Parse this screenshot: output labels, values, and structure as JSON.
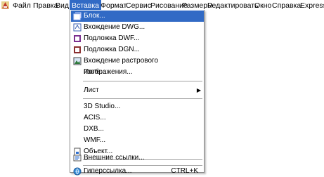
{
  "menubar": {
    "items": [
      {
        "label": "Файл"
      },
      {
        "label": "Правка"
      },
      {
        "label": "Вид"
      },
      {
        "label": "Вставка"
      },
      {
        "label": "Формат"
      },
      {
        "label": "Сервис"
      },
      {
        "label": "Рисование"
      },
      {
        "label": "Размеры"
      },
      {
        "label": "Редактировать"
      },
      {
        "label": "Окно"
      },
      {
        "label": "Справка"
      },
      {
        "label": "Express"
      }
    ]
  },
  "insert_menu": {
    "items": [
      {
        "label": "Блок...",
        "icon": "block-icon"
      },
      {
        "label": "Вхождение DWG...",
        "icon": "dwg-reference-icon"
      },
      {
        "label": "Подложка DWF...",
        "icon": "dwf-underlay-icon"
      },
      {
        "label": "Подложка DGN...",
        "icon": "dgn-underlay-icon"
      },
      {
        "label": "Вхождение растрового изображения...",
        "icon": "raster-image-icon"
      },
      {
        "label": "Поле..."
      },
      {
        "label": "Лист"
      },
      {
        "label": "3D Studio..."
      },
      {
        "label": "ACIS..."
      },
      {
        "label": "DXB..."
      },
      {
        "label": "WMF..."
      },
      {
        "label": "Объект...",
        "icon": "ole-object-icon"
      },
      {
        "label": "Внешние ссылки...",
        "icon": "xref-icon"
      },
      {
        "label": "Гиперссылка...",
        "icon": "hyperlink-icon",
        "shortcut": "CTRL+K"
      }
    ]
  },
  "colors": {
    "highlight": "#316ac5",
    "menu_bg": "#ffffff"
  }
}
